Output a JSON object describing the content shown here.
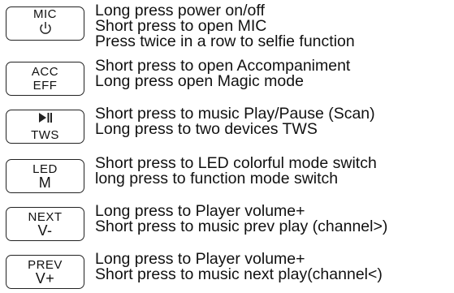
{
  "buttons": [
    {
      "id": "mic",
      "key_top": "MIC",
      "key_bottom": "",
      "key_icon": "power-icon",
      "lines": [
        "Long press power on/off",
        "Short press to open MIC",
        "Press twice in a row  to  selfie function"
      ]
    },
    {
      "id": "acc",
      "key_top": "ACC",
      "key_bottom": "EFF",
      "lines": [
        "Short press to open Accompaniment",
        "Long press open Magic mode"
      ]
    },
    {
      "id": "tws",
      "key_top": "",
      "key_icon": "play-pause-icon",
      "key_bottom": "TWS",
      "lines": [
        "Short press to music Play/Pause  (Scan)",
        "Long press to two devices TWS"
      ]
    },
    {
      "id": "led",
      "key_top": "LED",
      "key_bottom": "M",
      "lines": [
        "Short press to LED colorful mode switch",
        "long press to function mode switch"
      ]
    },
    {
      "id": "next",
      "key_top": "NEXT",
      "key_bottom": "V-",
      "lines": [
        "Long press to Player volume+",
        "Short press to music prev play (channel>)"
      ]
    },
    {
      "id": "prev",
      "key_top": "PREV",
      "key_bottom": "V+",
      "lines": [
        "Long press to Player volume+",
        "Short press to music next play(channel<)"
      ]
    }
  ]
}
